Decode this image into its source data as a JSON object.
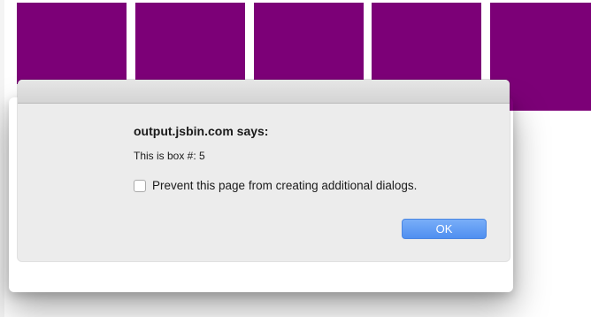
{
  "boxes": {
    "color": "#7c0077",
    "count": 5
  },
  "dialog": {
    "title": "output.jsbin.com says:",
    "message": "This is box #: 5",
    "prevent_checkbox": {
      "label": "Prevent this page from creating additional dialogs.",
      "checked": false
    },
    "ok_label": "OK",
    "ok_color": "#4f8ff0"
  }
}
